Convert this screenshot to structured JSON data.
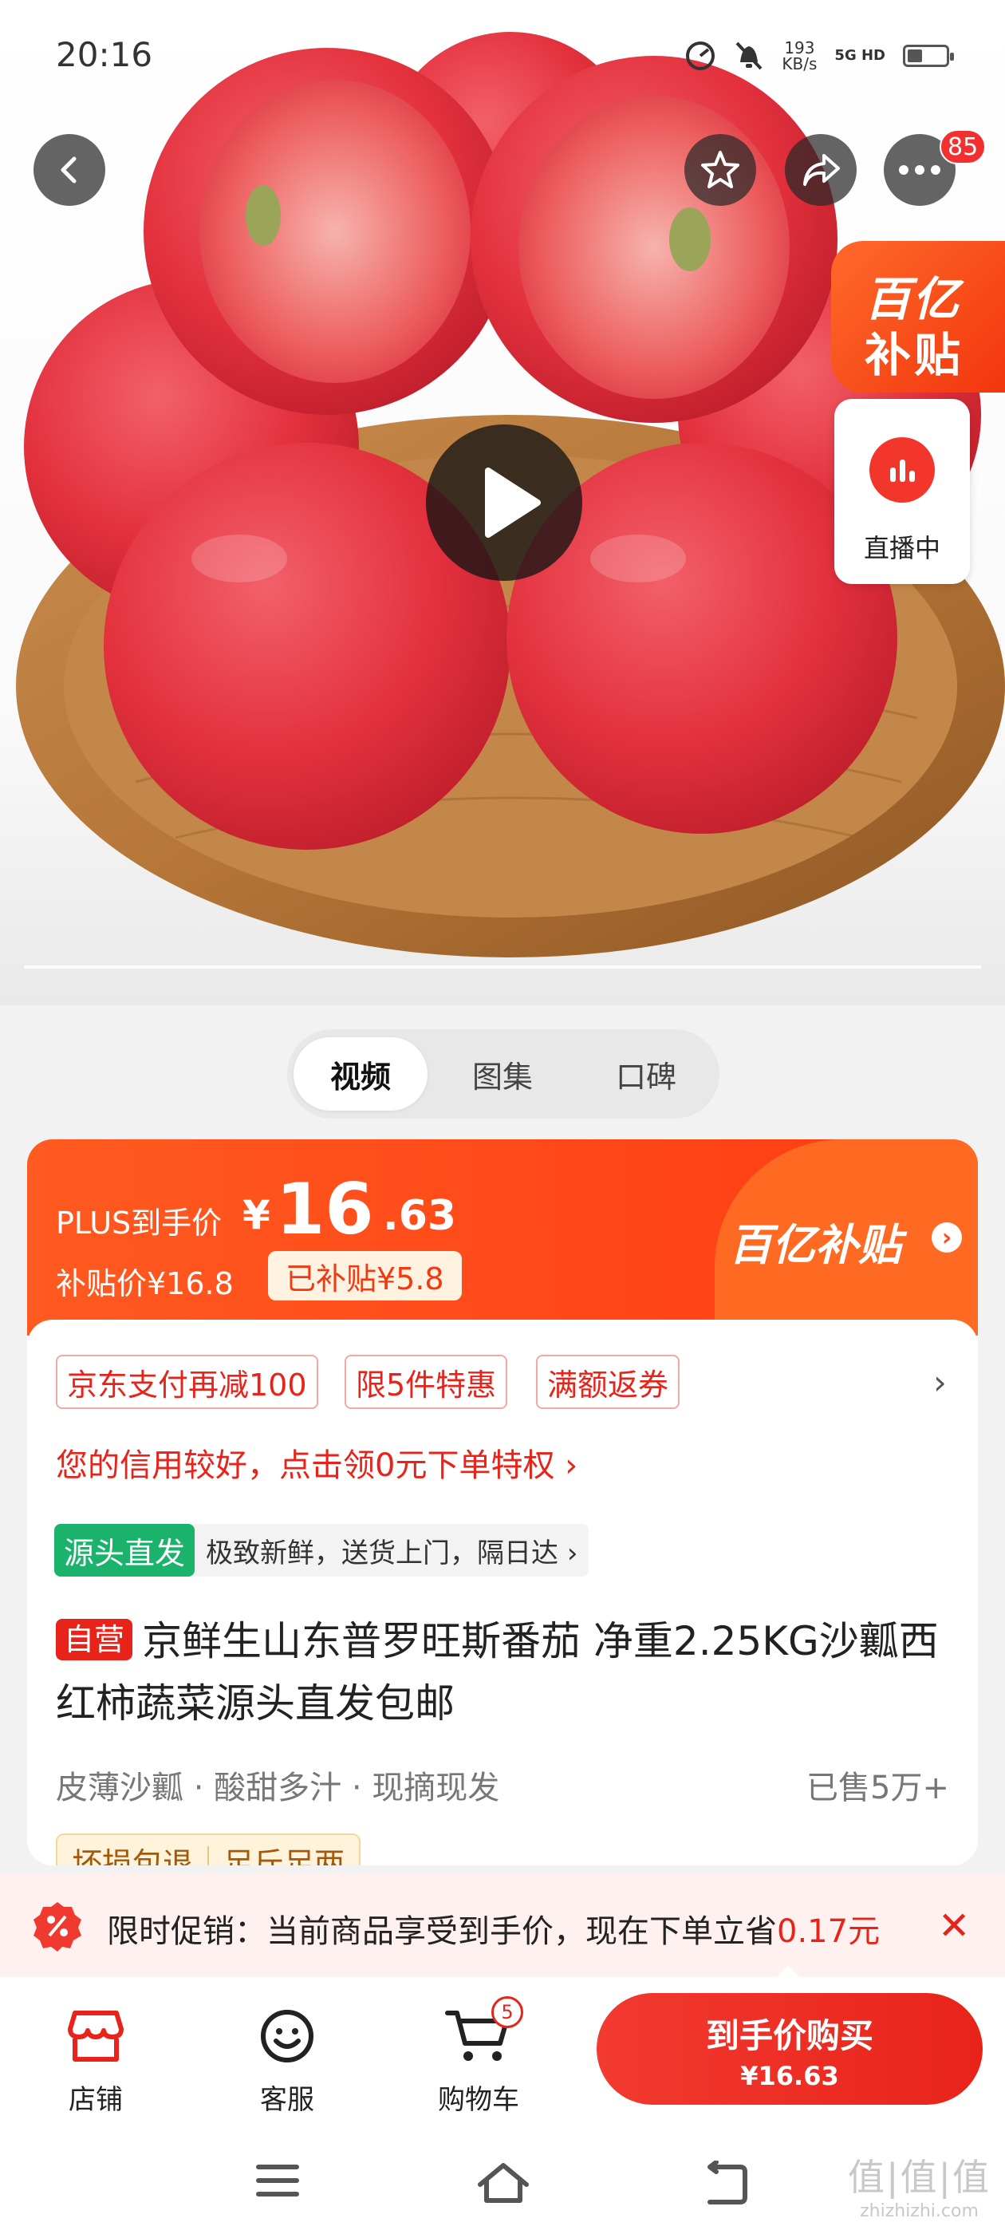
{
  "status_bar": {
    "time": "20:16",
    "speed_value": "193",
    "speed_unit": "KB/s",
    "network": "5G HD"
  },
  "hero": {
    "more_badge": "85",
    "subsidy_line1": "百亿",
    "subsidy_line2": "补贴",
    "live_label": "直播中"
  },
  "media_tabs": [
    "视频",
    "图集",
    "口碑"
  ],
  "price": {
    "plus_label": "PLUS到手价",
    "currency": "¥",
    "main_int": "16",
    "main_dec": ".63",
    "subsidy_price": "补贴价¥16.8",
    "subsidized_tag": "已补贴¥5.8",
    "logo_text": "百亿补贴"
  },
  "promo_chips": [
    "京东支付再减100",
    "限5件特惠",
    "满额返券"
  ],
  "credit_text": "您的信用较好，点击领0元下单特权 ›",
  "origin": {
    "tag": "源头直发",
    "desc": "极致新鲜，送货上门，隔日达 ›"
  },
  "product": {
    "self_tag": "自营",
    "title": "京鲜生山东普罗旺斯番茄 净重2.25KG沙瓤西红柿蔬菜源头直发包邮",
    "features": [
      "皮薄沙瓤",
      "酸甜多汁",
      "现摘现发"
    ],
    "sold": "已售5万+",
    "guarantees": [
      "坏损包退",
      "足斤足两"
    ]
  },
  "promo_bar": {
    "prefix": "限时促销：当前商品享受到手价，现在下单立省",
    "amount": "0.17元"
  },
  "bottom_bar": {
    "store": "店铺",
    "service": "客服",
    "cart": "购物车",
    "cart_count": "5",
    "buy_label": "到手价购买",
    "buy_price": "¥16.63"
  },
  "watermark": {
    "top": "值|值|值",
    "bottom": "zhizhizhi.com"
  },
  "colors": {
    "accent": "#e8231a",
    "orange": "#ff4a18",
    "green": "#1bb36b"
  }
}
